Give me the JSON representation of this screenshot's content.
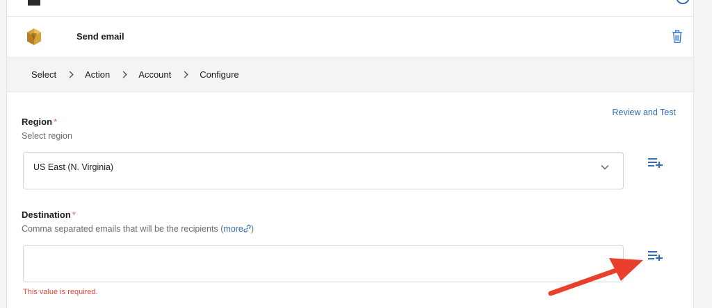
{
  "step": {
    "title": "Send email",
    "icon": "amazon-ses-icon",
    "delete_icon": "trash-icon"
  },
  "breadcrumb": {
    "items": [
      "Select",
      "Action",
      "Account",
      "Configure"
    ]
  },
  "review_link": "Review and Test",
  "region": {
    "label": "Region",
    "required_mark": "*",
    "help": "Select region",
    "value": "US East (N. Virginia)"
  },
  "destination": {
    "label": "Destination",
    "required_mark": "*",
    "help": "Comma separated emails that will be the recipients (",
    "more_link": "more",
    "help_suffix": ")",
    "value": "",
    "error": "This value is required."
  },
  "colors": {
    "accent": "#2f6db5",
    "error": "#e0483a",
    "annotation_arrow": "#e8402c"
  }
}
